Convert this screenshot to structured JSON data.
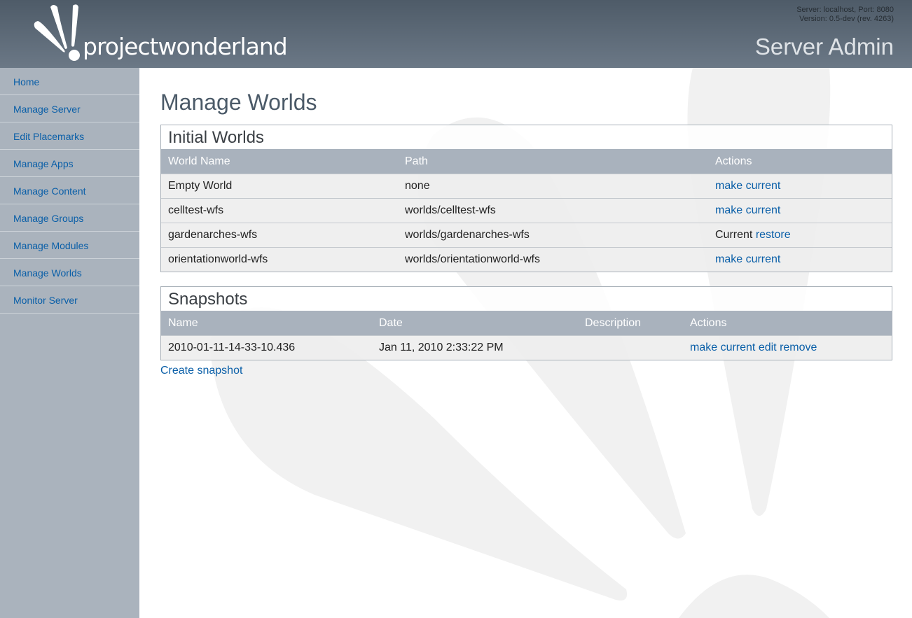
{
  "header": {
    "logo_text": "projectwonderland",
    "server_line": "Server: localhost, Port: 8080",
    "version_line": "Version: 0.5-dev (rev. 4263)",
    "app_title": "Server Admin"
  },
  "sidebar": {
    "items": [
      {
        "label": "Home"
      },
      {
        "label": "Manage Server"
      },
      {
        "label": "Edit Placemarks"
      },
      {
        "label": "Manage Apps"
      },
      {
        "label": "Manage Content"
      },
      {
        "label": "Manage Groups"
      },
      {
        "label": "Manage Modules"
      },
      {
        "label": "Manage Worlds"
      },
      {
        "label": "Monitor Server"
      }
    ]
  },
  "main": {
    "title": "Manage Worlds",
    "initial_worlds": {
      "title": "Initial Worlds",
      "headers": [
        "World Name",
        "Path",
        "Actions"
      ],
      "rows": [
        {
          "name": "Empty World",
          "path": "none",
          "status": "",
          "action": "make current"
        },
        {
          "name": "celltest-wfs",
          "path": "worlds/celltest-wfs",
          "status": "",
          "action": "make current"
        },
        {
          "name": "gardenarches-wfs",
          "path": "worlds/gardenarches-wfs",
          "status": "Current",
          "action": "restore"
        },
        {
          "name": "orientationworld-wfs",
          "path": "worlds/orientationworld-wfs",
          "status": "",
          "action": "make current"
        }
      ]
    },
    "snapshots": {
      "title": "Snapshots",
      "headers": [
        "Name",
        "Date",
        "Description",
        "Actions"
      ],
      "rows": [
        {
          "name": "2010-01-11-14-33-10.436",
          "date": "Jan 11, 2010 2:33:22 PM",
          "description": "",
          "actions": {
            "make_current": "make current",
            "edit": "edit",
            "remove": "remove"
          }
        }
      ]
    },
    "create_snapshot": "Create snapshot"
  },
  "colors": {
    "header_dark": "#4e5b68",
    "header_light": "#6b7886",
    "sidebar_bg": "#aab3bd",
    "link": "#0a5fa8",
    "table_header": "#a9b2bd",
    "watermark": "#f1f1f1"
  }
}
